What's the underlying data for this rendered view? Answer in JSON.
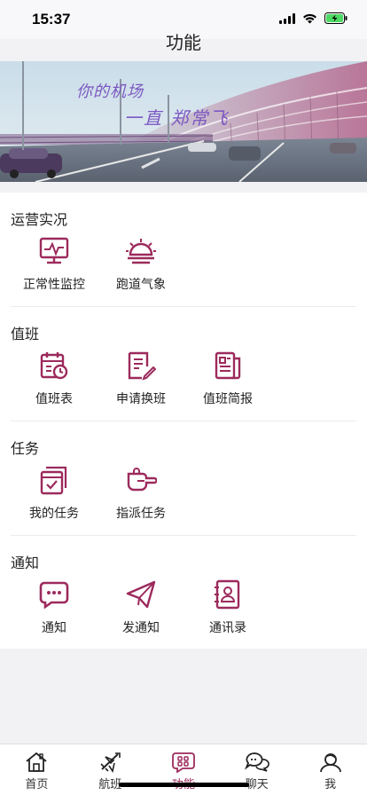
{
  "status": {
    "time": "15:37"
  },
  "header": {
    "title": "功能"
  },
  "banner": {
    "line1": "你的机场",
    "line2": "一直 郑常飞"
  },
  "colors": {
    "accent": "#9c2a5c",
    "battery": "#4cd964"
  },
  "sections": [
    {
      "title": "运营实况",
      "items": [
        {
          "label": "正常性监控",
          "icon": "monitor-icon"
        },
        {
          "label": "跑道气象",
          "icon": "weather-icon"
        }
      ]
    },
    {
      "title": "值班",
      "items": [
        {
          "label": "值班表",
          "icon": "calendar-clock-icon"
        },
        {
          "label": "申请换班",
          "icon": "edit-document-icon"
        },
        {
          "label": "值班简报",
          "icon": "report-icon"
        }
      ]
    },
    {
      "title": "任务",
      "items": [
        {
          "label": "我的任务",
          "icon": "task-list-icon"
        },
        {
          "label": "指派任务",
          "icon": "point-hand-icon"
        }
      ]
    },
    {
      "title": "通知",
      "items": [
        {
          "label": "通知",
          "icon": "message-icon"
        },
        {
          "label": "发通知",
          "icon": "send-icon"
        },
        {
          "label": "通讯录",
          "icon": "contacts-icon"
        }
      ]
    }
  ],
  "tabs": [
    {
      "label": "首页",
      "icon": "home-icon"
    },
    {
      "label": "航班",
      "icon": "flight-icon"
    },
    {
      "label": "功能",
      "icon": "functions-icon",
      "active": true
    },
    {
      "label": "聊天",
      "icon": "chat-icon"
    },
    {
      "label": "我",
      "icon": "profile-icon"
    }
  ]
}
